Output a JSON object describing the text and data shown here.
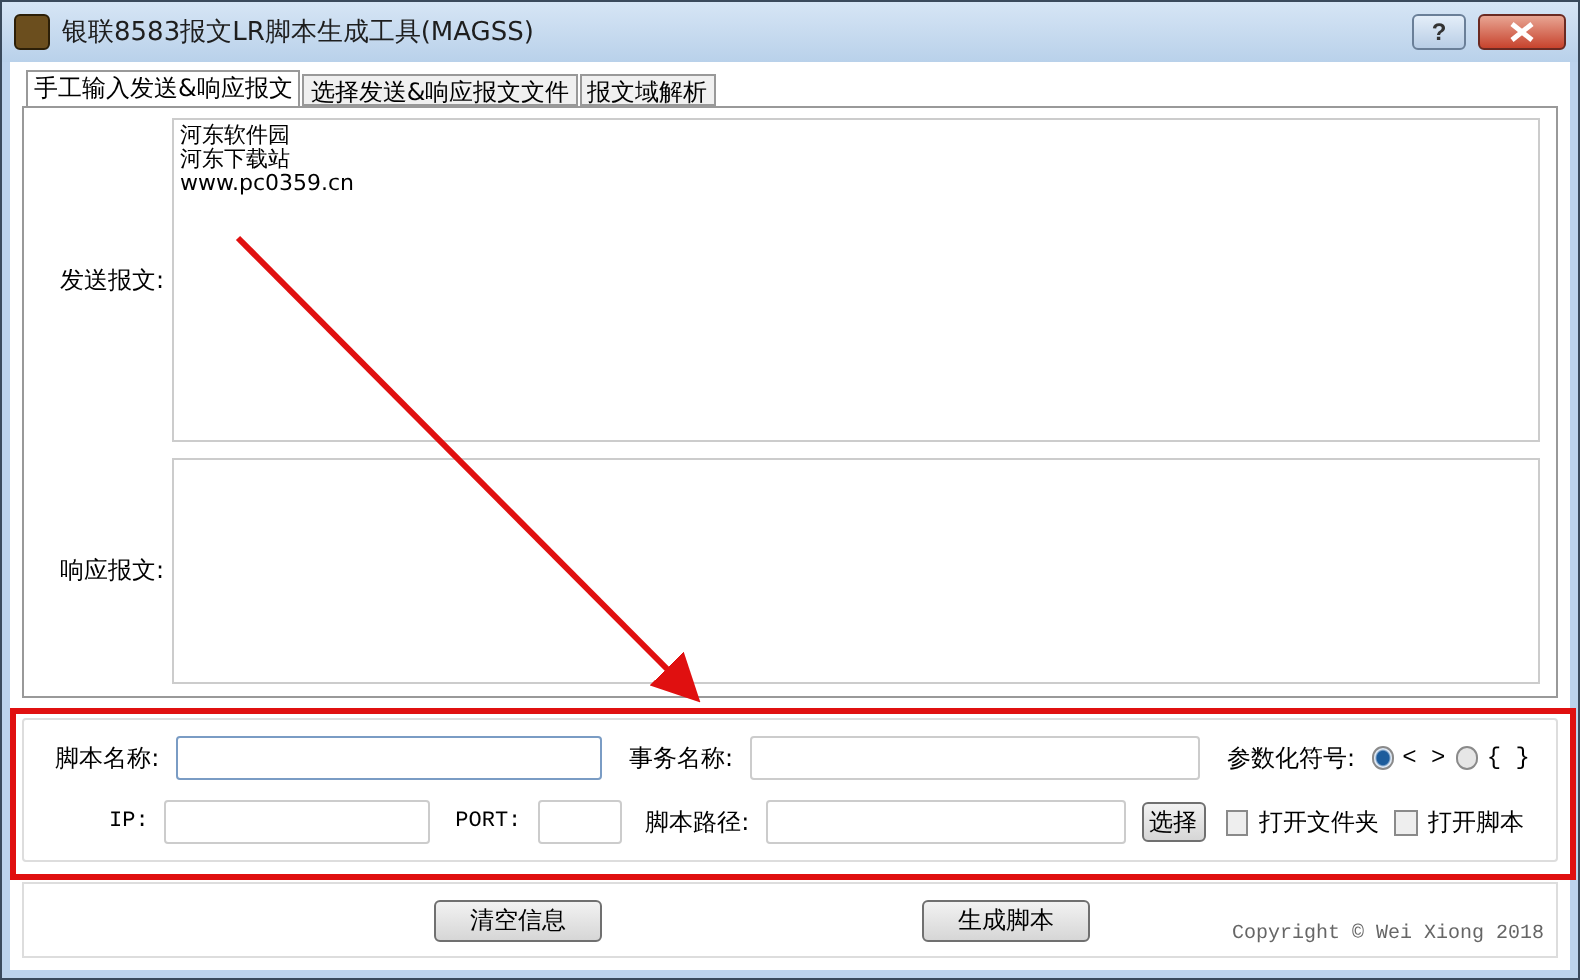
{
  "window": {
    "title": "银联8583报文LR脚本生成工具(MAGSS)",
    "help_button": "?"
  },
  "tabs": [
    {
      "label": "手工输入发送&响应报文",
      "selected": true
    },
    {
      "label": "选择发送&响应报文文件",
      "selected": false
    },
    {
      "label": "报文域解析",
      "selected": false
    }
  ],
  "send_message": {
    "label": "发送报文:",
    "lines": [
      "河东软件园",
      "河东下载站",
      "www.pc0359.cn"
    ]
  },
  "response_message": {
    "label": "响应报文:"
  },
  "form": {
    "script_name": {
      "label": "脚本名称:"
    },
    "transaction_name": {
      "label": "事务名称:"
    },
    "param_symbol": {
      "label": "参数化符号:",
      "options": [
        {
          "label": "< >",
          "selected": true
        },
        {
          "label": "{ }",
          "selected": false
        }
      ]
    },
    "ip": {
      "label": "IP:"
    },
    "port": {
      "label": "PORT:"
    },
    "script_path": {
      "label": "脚本路径:"
    },
    "choose_button": "选择",
    "checkboxes": [
      {
        "label": "打开文件夹",
        "checked": false
      },
      {
        "label": "打开脚本",
        "checked": false
      }
    ]
  },
  "buttons": [
    "清空信息",
    "生成脚本"
  ],
  "copyright": "Copyright © Wei Xiong 2018"
}
